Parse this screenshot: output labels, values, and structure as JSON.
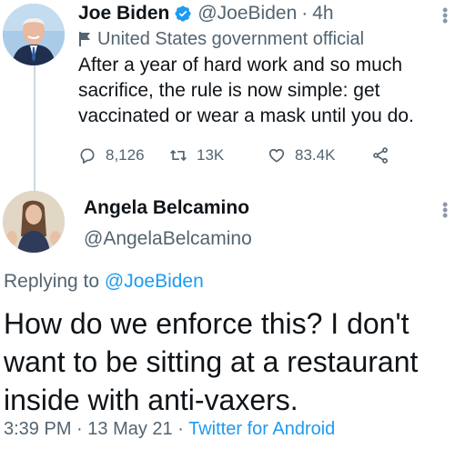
{
  "tweet1": {
    "name": "Joe Biden",
    "handle": "@JoeBiden",
    "separator": "·",
    "time": "4h",
    "label": "United States government official",
    "text": "After a year of hard work and so much sacrifice, the rule is now simple: get vaccinated or wear a mask until you do.",
    "stats": {
      "replies": "8,126",
      "retweets": "13K",
      "likes": "83.4K"
    }
  },
  "tweet2": {
    "name": "Angela Belcamino",
    "handle": "@AngelaBelcamino",
    "replying_prefix": "Replying to",
    "replying_to": "@JoeBiden",
    "text": "How do we enforce this? I don't want to be sitting at a restaurant inside with anti-vaxers.",
    "time": "3:39 PM",
    "sep1": "·",
    "date": "13 May 21",
    "sep2": "·",
    "source": "Twitter for Android"
  },
  "colors": {
    "link": "#1d9bf0",
    "secondary": "#536471",
    "verified": "#1d9bf0",
    "thread": "#cfd9de"
  }
}
